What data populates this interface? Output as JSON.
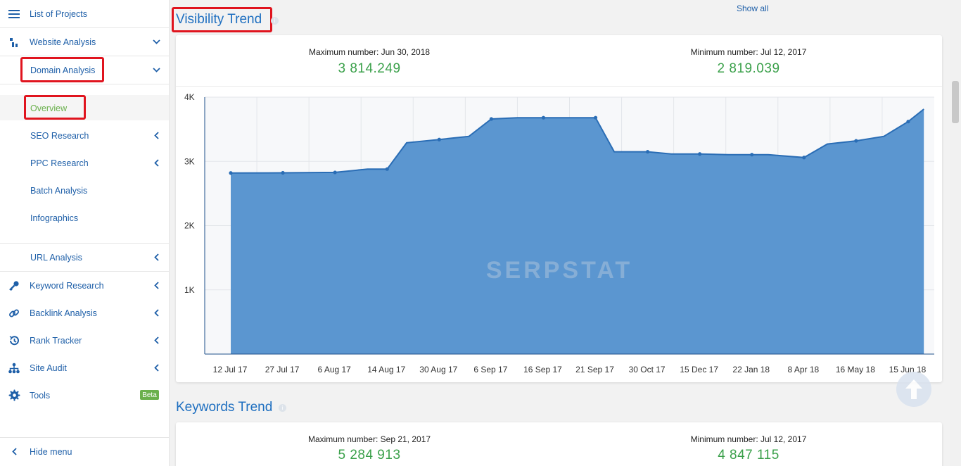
{
  "sidebar": {
    "list_projects": "List of Projects",
    "website_analysis": "Website Analysis",
    "domain_analysis": "Domain Analysis",
    "overview": "Overview",
    "seo_research": "SEO Research",
    "ppc_research": "PPC Research",
    "batch_analysis": "Batch Analysis",
    "infographics": "Infographics",
    "url_analysis": "URL Analysis",
    "keyword_research": "Keyword Research",
    "backlink_analysis": "Backlink Analysis",
    "rank_tracker": "Rank Tracker",
    "site_audit": "Site Audit",
    "tools": "Tools",
    "beta": "Beta",
    "hide_menu": "Hide menu"
  },
  "main": {
    "show_all": "Show all",
    "visibility": {
      "title": "Visibility Trend",
      "max_label": "Maximum number: Jun 30, 2018",
      "max_value": "3 814.249",
      "min_label": "Minimum number: Jul 12, 2017",
      "min_value": "2 819.039",
      "watermark": "SERPSTAT"
    },
    "keywords": {
      "title": "Keywords Trend",
      "max_label": "Maximum number: Sep 21, 2017",
      "max_value": "5 284 913",
      "min_label": "Minimum number: Jul 12, 2017",
      "min_value": "4 847 115"
    }
  },
  "colors": {
    "accent": "#1e6fc0",
    "area_fill": "#5b96d0",
    "area_line": "#2a6db5",
    "positive": "#3aa04a",
    "highlight": "#e0141e",
    "beta": "#6ab04c"
  },
  "chart_data": {
    "type": "area",
    "title": "Visibility Trend",
    "xlabel": "",
    "ylabel": "",
    "ylim": [
      0,
      4000
    ],
    "y_ticks": [
      "1K",
      "2K",
      "3K",
      "4K"
    ],
    "y_tick_values": [
      1000,
      2000,
      3000,
      4000
    ],
    "x_tick_labels": [
      "12 Jul 17",
      "27 Jul 17",
      "6 Aug 17",
      "14 Aug 17",
      "30 Aug 17",
      "6 Sep 17",
      "16 Sep 17",
      "21 Sep 17",
      "30 Oct 17",
      "15 Dec 17",
      "22 Jan 18",
      "8 Apr 18",
      "16 May 18",
      "15 Jun 18"
    ],
    "grid": true,
    "points": [
      {
        "x": "12 Jul 17",
        "y": 2819
      },
      {
        "x": "27 Jul 17",
        "y": 2822
      },
      {
        "x": "6 Aug 17",
        "y": 2828
      },
      {
        "x": "11 Aug 17",
        "y": 2880
      },
      {
        "x": "14 Aug 17",
        "y": 2880
      },
      {
        "x": "20 Aug 17",
        "y": 3290
      },
      {
        "x": "30 Aug 17",
        "y": 3340
      },
      {
        "x": "3 Sep 17",
        "y": 3390
      },
      {
        "x": "6 Sep 17",
        "y": 3660
      },
      {
        "x": "11 Sep 17",
        "y": 3680
      },
      {
        "x": "16 Sep 17",
        "y": 3680
      },
      {
        "x": "19 Sep 17",
        "y": 3680
      },
      {
        "x": "21 Sep 17",
        "y": 3680
      },
      {
        "x": "5 Oct 17",
        "y": 3150
      },
      {
        "x": "30 Oct 17",
        "y": 3150
      },
      {
        "x": "20 Nov 17",
        "y": 3115
      },
      {
        "x": "15 Dec 17",
        "y": 3115
      },
      {
        "x": "5 Jan 18",
        "y": 3105
      },
      {
        "x": "22 Jan 18",
        "y": 3105
      },
      {
        "x": "15 Feb 18",
        "y": 3105
      },
      {
        "x": "8 Apr 18",
        "y": 3060
      },
      {
        "x": "25 Apr 18",
        "y": 3270
      },
      {
        "x": "16 May 18",
        "y": 3320
      },
      {
        "x": "1 Jun 18",
        "y": 3390
      },
      {
        "x": "15 Jun 18",
        "y": 3620
      },
      {
        "x": "30 Jun 18",
        "y": 3814
      }
    ],
    "marker_dates": [
      "12 Jul 17",
      "27 Jul 17",
      "6 Aug 17",
      "14 Aug 17",
      "30 Aug 17",
      "6 Sep 17",
      "16 Sep 17",
      "21 Sep 17",
      "30 Oct 17",
      "15 Dec 17",
      "22 Jan 18",
      "8 Apr 18",
      "16 May 18",
      "15 Jun 18"
    ]
  }
}
